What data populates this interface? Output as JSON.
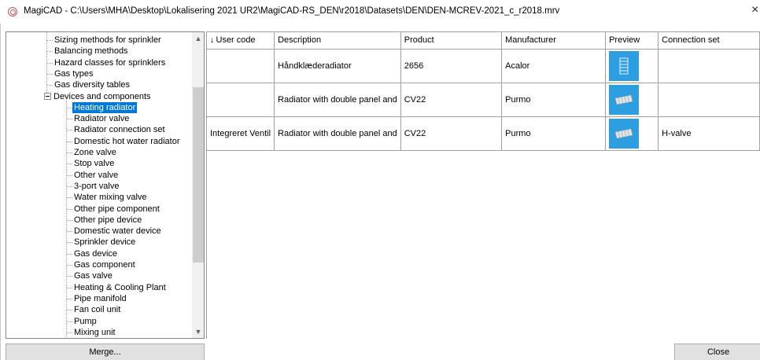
{
  "window": {
    "title": "MagiCAD - C:\\Users\\MHA\\Desktop\\Lokalisering 2021 UR2\\MagiCAD-RS_DEN\\r2018\\Datasets\\DEN\\DEN-MCREV-2021_c_r2018.mrv",
    "close_glyph": "×"
  },
  "tree": {
    "items": [
      {
        "label": "Sizing methods for sprinkler",
        "level": 2
      },
      {
        "label": "Balancing methods",
        "level": 2
      },
      {
        "label": "Hazard classes for sprinklers",
        "level": 2
      },
      {
        "label": "Gas types",
        "level": 2
      },
      {
        "label": "Gas diversity tables",
        "level": 2
      },
      {
        "label": "Devices and components",
        "level": 1,
        "expanded": true
      },
      {
        "label": "Heating radiator",
        "level": 3,
        "selected": true
      },
      {
        "label": "Radiator valve",
        "level": 3
      },
      {
        "label": "Radiator connection set",
        "level": 3
      },
      {
        "label": "Domestic hot water radiator",
        "level": 3
      },
      {
        "label": "Zone valve",
        "level": 3
      },
      {
        "label": "Stop valve",
        "level": 3
      },
      {
        "label": "Other valve",
        "level": 3
      },
      {
        "label": "3-port valve",
        "level": 3
      },
      {
        "label": "Water mixing valve",
        "level": 3
      },
      {
        "label": "Other pipe component",
        "level": 3
      },
      {
        "label": "Other pipe device",
        "level": 3
      },
      {
        "label": "Domestic water device",
        "level": 3
      },
      {
        "label": "Sprinkler device",
        "level": 3
      },
      {
        "label": "Gas device",
        "level": 3
      },
      {
        "label": "Gas component",
        "level": 3
      },
      {
        "label": "Gas valve",
        "level": 3
      },
      {
        "label": "Heating & Cooling Plant",
        "level": 3
      },
      {
        "label": "Pipe manifold",
        "level": 3
      },
      {
        "label": "Fan coil unit",
        "level": 3
      },
      {
        "label": "Pump",
        "level": 3
      },
      {
        "label": "Mixing unit",
        "level": 3
      }
    ],
    "scroll_up_glyph": "▲",
    "scroll_down_glyph": "▼"
  },
  "grid": {
    "sort_glyph": "↓",
    "columns": [
      "User code",
      "Description",
      "Product",
      "Manufacturer",
      "Preview",
      "Connection set"
    ],
    "rows": [
      {
        "user_code": "",
        "description": "Håndklæderadiator",
        "product": "2656",
        "manufacturer": "Acalor",
        "preview": "towel-radiator-icon",
        "connection_set": ""
      },
      {
        "user_code": "",
        "description": "Radiator with double panel and",
        "product": "CV22",
        "manufacturer": "Purmo",
        "preview": "panel-radiator-icon",
        "connection_set": ""
      },
      {
        "user_code": "Integreret Ventil",
        "description": "Radiator with double panel and",
        "product": "CV22",
        "manufacturer": "Purmo",
        "preview": "panel-radiator-icon",
        "connection_set": "H-valve"
      }
    ],
    "preview_color": "#2d9ee0"
  },
  "buttons": {
    "merge": "Merge...",
    "close": "Close"
  }
}
